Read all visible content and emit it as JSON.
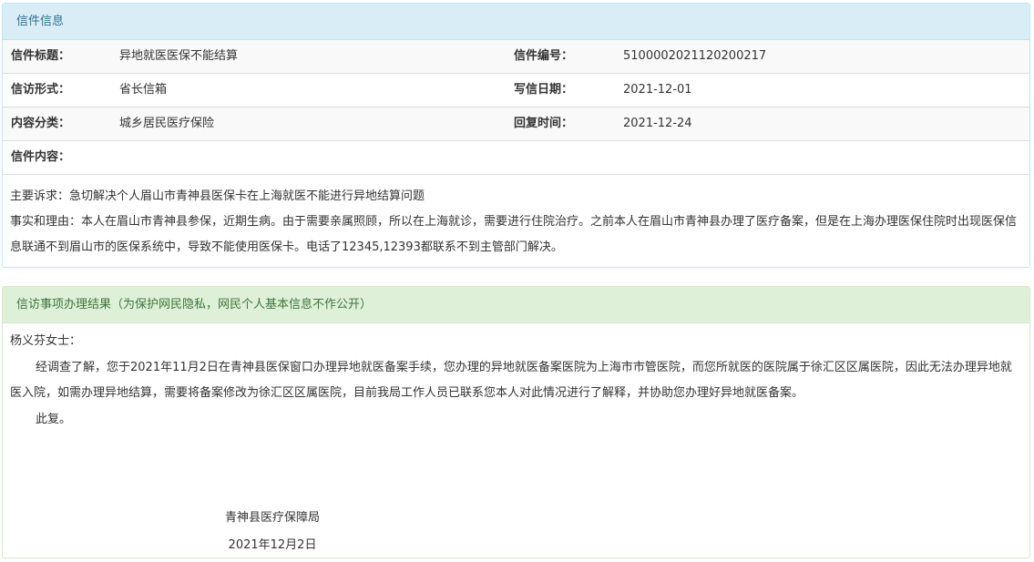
{
  "letter_info": {
    "heading": "信件信息",
    "rows": [
      {
        "label1": "信件标题：",
        "value1": "异地就医医保不能结算",
        "label2": "信件编号：",
        "value2": "5100002021120200217"
      },
      {
        "label1": "信访形式：",
        "value1": "省长信箱",
        "label2": "写信日期：",
        "value2": "2021-12-01"
      },
      {
        "label1": "内容分类：",
        "value1": "城乡居民医疗保险",
        "label2": "回复时间：",
        "value2": "2021-12-24"
      }
    ],
    "content_label": "信件内容：",
    "content": [
      "主要诉求：急切解决个人眉山市青神县医保卡在上海就医不能进行异地结算问题",
      "事实和理由：本人在眉山市青神县参保，近期生病。由于需要亲属照顾，所以在上海就诊，需要进行住院治疗。之前本人在眉山市青神县办理了医疗备案，但是在上海办理医保住院时出现医保信息联通不到眉山市的医保系统中，导致不能使用医保卡。电话了12345,12393都联系不到主管部门解决。"
    ]
  },
  "result": {
    "heading": "信访事项办理结果（为保护网民隐私，网民个人基本信息不作公开）",
    "greeting": "杨义芬女士：",
    "body": "经调查了解，您于2021年11月2日在青神县医保窗口办理异地就医备案手续，您办理的异地就医备案医院为上海市市管医院，而您所就医的医院属于徐汇区区属医院，因此无法办理异地就医入院，如需办理异地结算，需要将备案修改为徐汇区区属医院，目前我局工作人员已联系您本人对此情况进行了解释，并协助您办理好异地就医备案。",
    "closing": "此复。",
    "org": "青神县医疗保障局",
    "date": "2021年12月2日"
  }
}
